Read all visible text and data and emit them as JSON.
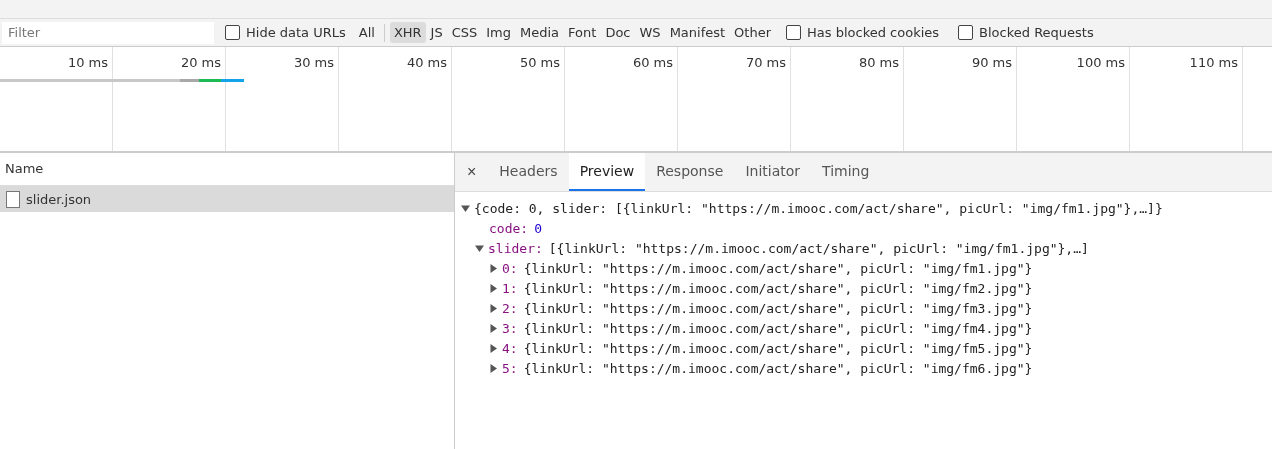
{
  "filter_bar": {
    "filter": {
      "placeholder": "Filter"
    },
    "hide_data_urls": {
      "label": "Hide data URLs",
      "checked": false
    },
    "types": [
      {
        "label": "All",
        "selected": false
      },
      {
        "label": "XHR",
        "selected": true
      },
      {
        "label": "JS",
        "selected": false
      },
      {
        "label": "CSS",
        "selected": false
      },
      {
        "label": "Img",
        "selected": false
      },
      {
        "label": "Media",
        "selected": false
      },
      {
        "label": "Font",
        "selected": false
      },
      {
        "label": "Doc",
        "selected": false
      },
      {
        "label": "WS",
        "selected": false
      },
      {
        "label": "Manifest",
        "selected": false
      },
      {
        "label": "Other",
        "selected": false
      }
    ],
    "options": [
      {
        "label": "Has blocked cookies",
        "checked": false
      },
      {
        "label": "Blocked Requests",
        "checked": false
      }
    ]
  },
  "overview": {
    "ticks": [
      "10 ms",
      "20 ms",
      "30 ms",
      "40 ms",
      "50 ms",
      "60 ms",
      "70 ms",
      "80 ms",
      "90 ms",
      "100 ms",
      "110 ms"
    ]
  },
  "requests": {
    "column": "Name",
    "rows": [
      {
        "name": "slider.json",
        "selected": true
      }
    ]
  },
  "detail": {
    "tabs": [
      {
        "label": "Headers",
        "selected": false
      },
      {
        "label": "Preview",
        "selected": true
      },
      {
        "label": "Response",
        "selected": false
      },
      {
        "label": "Initiator",
        "selected": false
      },
      {
        "label": "Timing",
        "selected": false
      }
    ],
    "close": "×",
    "tree": {
      "value": "{code: 0, slider: [{linkUrl: \"https://m.imooc.com/act/share\", picUrl: \"img/fm1.jpg\"},…]}",
      "expanded": true,
      "kind": "object",
      "children": [
        {
          "key": "code:",
          "value": "0",
          "kind": "number"
        },
        {
          "key": "slider:",
          "value": "[{linkUrl: \"https://m.imooc.com/act/share\", picUrl: \"img/fm1.jpg\"},…]",
          "expanded": true,
          "kind": "object",
          "children": [
            {
              "key": "0:",
              "value": "{linkUrl: \"https://m.imooc.com/act/share\", picUrl: \"img/fm1.jpg\"}",
              "expanded": false,
              "kind": "object"
            },
            {
              "key": "1:",
              "value": "{linkUrl: \"https://m.imooc.com/act/share\", picUrl: \"img/fm2.jpg\"}",
              "expanded": false,
              "kind": "object"
            },
            {
              "key": "2:",
              "value": "{linkUrl: \"https://m.imooc.com/act/share\", picUrl: \"img/fm3.jpg\"}",
              "expanded": false,
              "kind": "object"
            },
            {
              "key": "3:",
              "value": "{linkUrl: \"https://m.imooc.com/act/share\", picUrl: \"img/fm4.jpg\"}",
              "expanded": false,
              "kind": "object"
            },
            {
              "key": "4:",
              "value": "{linkUrl: \"https://m.imooc.com/act/share\", picUrl: \"img/fm5.jpg\"}",
              "expanded": false,
              "kind": "object"
            },
            {
              "key": "5:",
              "value": "{linkUrl: \"https://m.imooc.com/act/share\", picUrl: \"img/fm6.jpg\"}",
              "expanded": false,
              "kind": "object"
            }
          ]
        }
      ]
    }
  }
}
